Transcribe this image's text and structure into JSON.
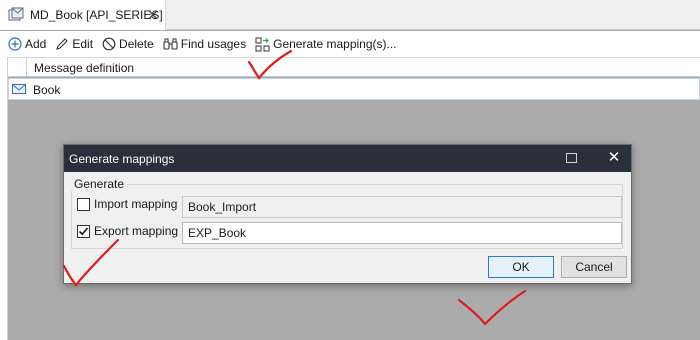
{
  "tab": {
    "title": "MD_Book [API_SERIES]",
    "close": "✕"
  },
  "toolbar": {
    "add": "Add",
    "edit": "Edit",
    "delete": "Delete",
    "find_usages": "Find usages",
    "generate": "Generate mapping(s)..."
  },
  "grid": {
    "column_header": "Message definition",
    "rows": [
      {
        "label": "Book"
      }
    ]
  },
  "dialog": {
    "title": "Generate mappings",
    "close": "✕",
    "group_title": "Generate",
    "import_label": "Import mapping",
    "import_checked": false,
    "import_value": "Book_Import",
    "export_label": "Export mapping",
    "export_checked": true,
    "export_value": "EXP_Book",
    "ok": "OK",
    "cancel": "Cancel"
  },
  "colors": {
    "title_bar": "#2b2f3b",
    "selected_row_border": "#bcd3ea",
    "default_button_border": "#2c7ad6",
    "annotation": "#e11b1b"
  }
}
